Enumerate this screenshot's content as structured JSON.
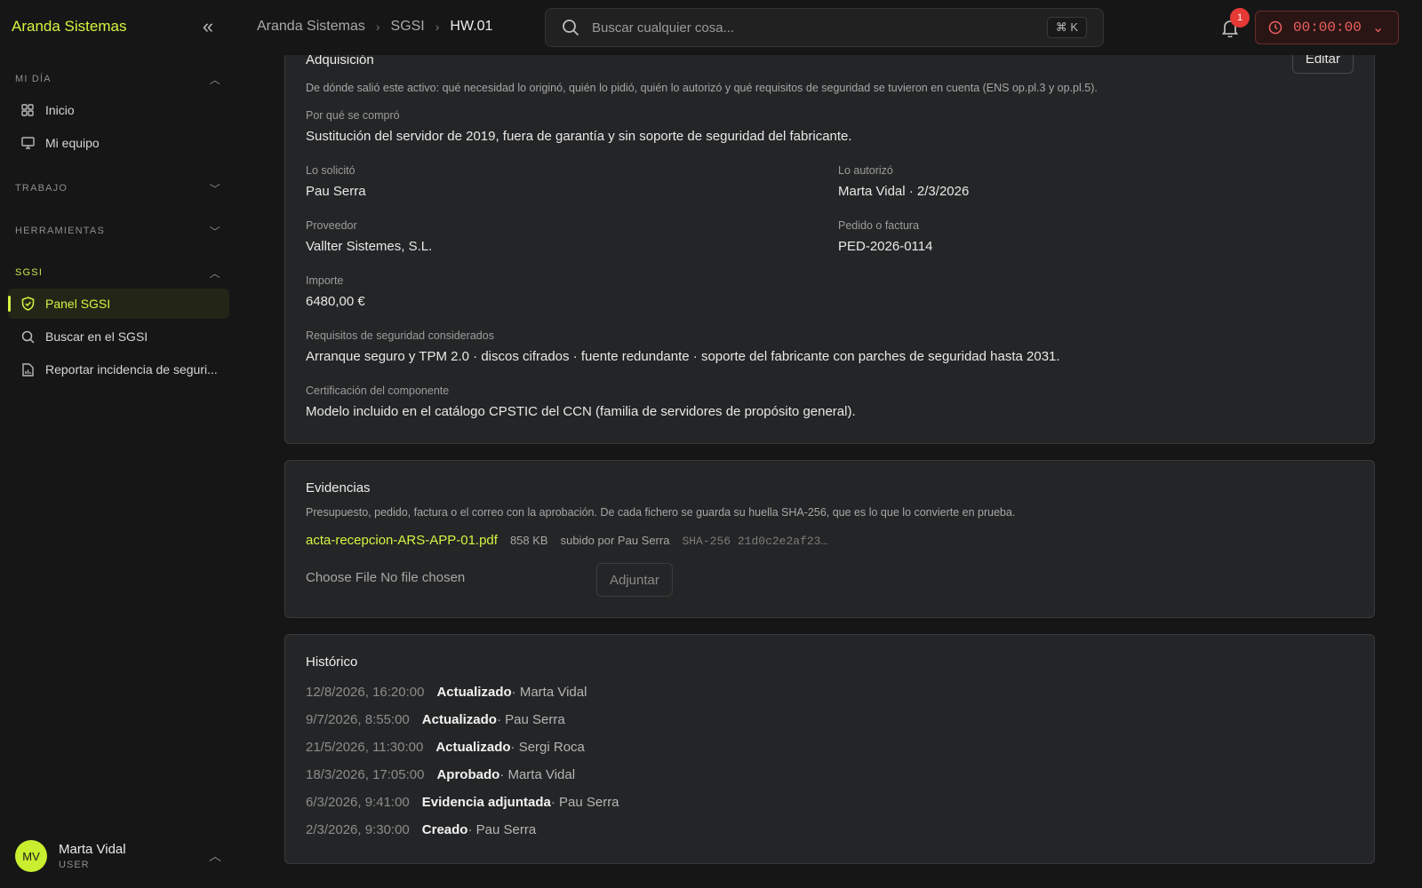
{
  "app": {
    "brand": "Aranda Sistemas"
  },
  "sidebar": {
    "sections": {
      "mi_dia": "MI DÍA",
      "trabajo": "TRABAJO",
      "herramientas": "HERRAMIENTAS",
      "sgsi": "SGSI"
    },
    "items": {
      "inicio": "Inicio",
      "mi_equipo": "Mi equipo",
      "panel_sgsi": "Panel SGSI",
      "buscar": "Buscar en el SGSI",
      "reportar": "Reportar incidencia de seguri..."
    },
    "user": {
      "initials": "MV",
      "name": "Marta Vidal",
      "role": "USER"
    }
  },
  "topbar": {
    "breadcrumbs": [
      "Aranda Sistemas",
      "SGSI",
      "HW.01"
    ],
    "search_placeholder": "Buscar cualquier cosa...",
    "search_shortcut": "⌘ K",
    "notifications_count": "1",
    "timer": "00:00:00"
  },
  "acquisition": {
    "title": "Adquisición",
    "edit_label": "Editar",
    "description": "De dónde salió este activo: qué necesidad lo originó, quién lo pidió, quién lo autorizó y qué requisitos de seguridad se tuvieron en cuenta (ENS op.pl.3 y op.pl.5).",
    "why_label": "Por qué se compró",
    "why_value": "Sustitución del servidor de 2019, fuera de garantía y sin soporte de seguridad del fabricante.",
    "requested_label": "Lo solicitó",
    "requested_value": "Pau Serra",
    "authorized_label": "Lo autorizó",
    "authorized_value": "Marta Vidal · 2/3/2026",
    "supplier_label": "Proveedor",
    "supplier_value": "Vallter Sistemes, S.L.",
    "order_label": "Pedido o factura",
    "order_value": "PED-2026-0114",
    "amount_label": "Importe",
    "amount_value": "6480,00 €",
    "requirements_label": "Requisitos de seguridad considerados",
    "requirements_value": "Arranque seguro y TPM 2.0 · discos cifrados · fuente redundante · soporte del fabricante con parches de seguridad hasta 2031.",
    "certification_label": "Certificación del componente",
    "certification_value": "Modelo incluido en el catálogo CPSTIC del CCN (familia de servidores de propósito general)."
  },
  "evidence": {
    "title": "Evidencias",
    "description": "Presupuesto, pedido, factura o el correo con la aprobación. De cada fichero se guarda su huella SHA-256, que es lo que lo convierte en prueba.",
    "file_name": "acta-recepcion-ARS-APP-01.pdf",
    "file_size": "858 KB",
    "file_uploader": "subido por Pau Serra",
    "file_hash": "SHA-256 21d0c2e2af23…",
    "file_input_text": "Choose File No file chosen",
    "attach_label": "Adjuntar"
  },
  "history": {
    "title": "Histórico",
    "rows": [
      {
        "ts": "12/8/2026, 16:20:00",
        "action": "Actualizado",
        "who": " · Marta Vidal"
      },
      {
        "ts": "9/7/2026, 8:55:00",
        "action": "Actualizado",
        "who": " · Pau Serra"
      },
      {
        "ts": "21/5/2026, 11:30:00",
        "action": "Actualizado",
        "who": " · Sergi Roca"
      },
      {
        "ts": "18/3/2026, 17:05:00",
        "action": "Aprobado",
        "who": " · Marta Vidal"
      },
      {
        "ts": "6/3/2026, 9:41:00",
        "action": "Evidencia adjuntada",
        "who": " · Pau Serra"
      },
      {
        "ts": "2/3/2026, 9:30:00",
        "action": "Creado",
        "who": " · Pau Serra"
      }
    ]
  },
  "colors": {
    "accent": "#d4f542",
    "danger": "#e53935",
    "background": "#161616",
    "card": "#242526"
  }
}
